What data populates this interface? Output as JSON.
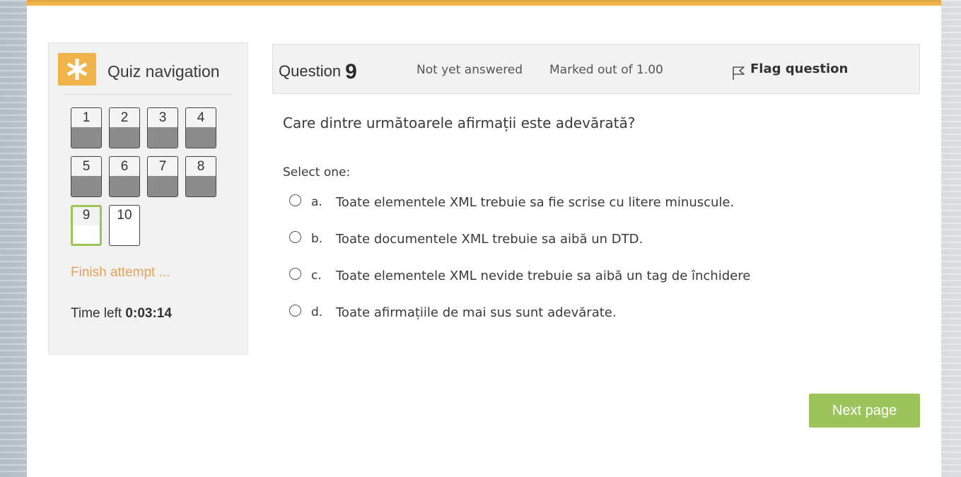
{
  "colors": {
    "accent": "#f0b44a",
    "current_outline": "#9cc45a",
    "link": "#e3a35a",
    "button": "#9cc45a"
  },
  "nav": {
    "icon": "asterisk-icon",
    "title": "Quiz navigation",
    "questions": [
      {
        "label": "1",
        "state": "answered"
      },
      {
        "label": "2",
        "state": "answered"
      },
      {
        "label": "3",
        "state": "answered"
      },
      {
        "label": "4",
        "state": "answered"
      },
      {
        "label": "5",
        "state": "answered"
      },
      {
        "label": "6",
        "state": "answered"
      },
      {
        "label": "7",
        "state": "answered"
      },
      {
        "label": "8",
        "state": "answered"
      },
      {
        "label": "9",
        "state": "current"
      },
      {
        "label": "10",
        "state": "unanswered"
      }
    ],
    "finish_link": "Finish attempt ...",
    "time_label": "Time left",
    "time_value": "0:03:14"
  },
  "question": {
    "label": "Question",
    "number": "9",
    "state": "Not yet answered",
    "marked": "Marked out of 1.00",
    "flag_icon": "flag-icon",
    "flag_label": "Flag question",
    "text": "Care dintre următoarele afirmații este adevărată?",
    "select_prompt": "Select one:",
    "options": [
      {
        "letter": "a.",
        "text": "Toate elementele XML trebuie sa fie scrise cu litere minuscule."
      },
      {
        "letter": "b.",
        "text": " Toate documentele XML trebuie sa aibă un DTD."
      },
      {
        "letter": "c.",
        "text": "Toate elementele XML nevide trebuie sa aibă un tag de închidere"
      },
      {
        "letter": "d.",
        "text": "Toate afirmațiile de mai sus sunt adevărate."
      }
    ]
  },
  "next_button": "Next page"
}
